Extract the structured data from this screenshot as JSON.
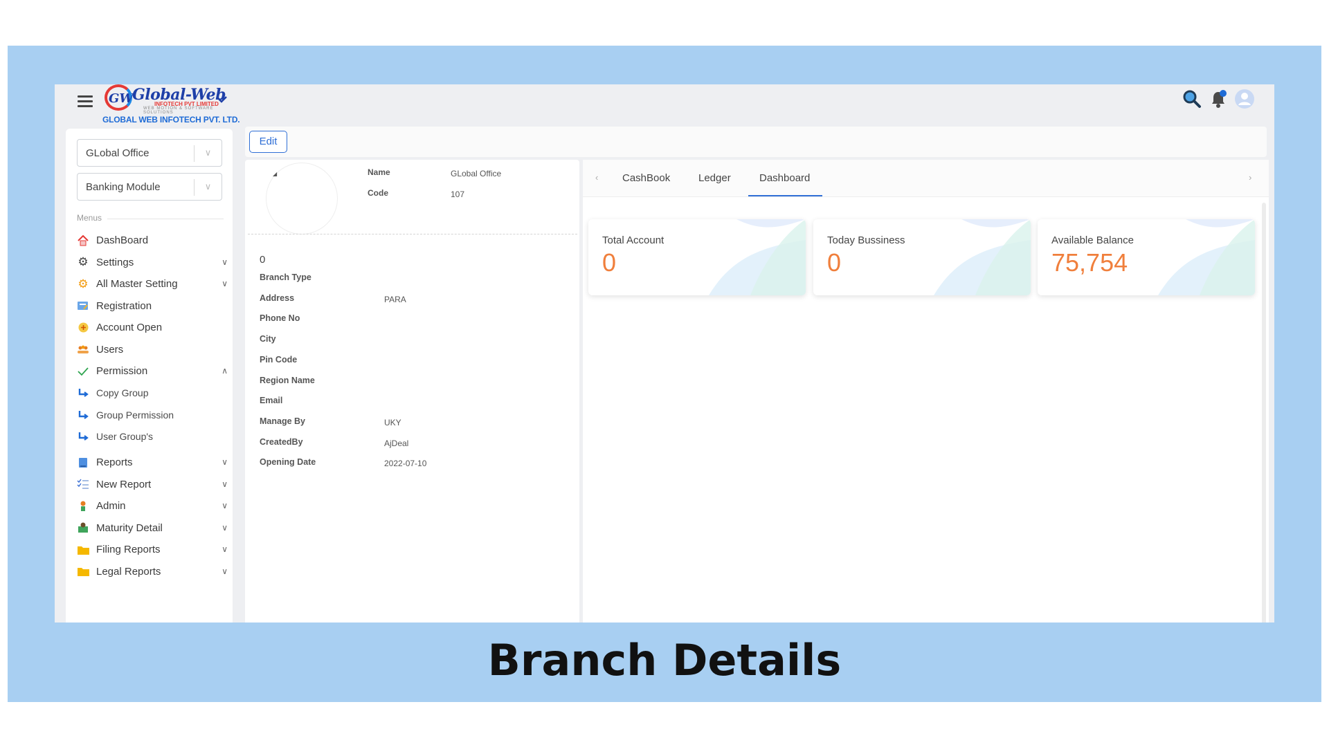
{
  "header": {
    "logo_text": "Global-Web",
    "logo_sub": "INFOTECH PVT LIMITED",
    "logo_tagline": "WEB MOTION & SOFTWARE SOLUTIONS",
    "company_name": "GLOBAL WEB INFOTECH PVT. LTD."
  },
  "sidebar": {
    "branch_select": "GLobal Office",
    "module_select": "Banking Module",
    "menus_label": "Menus",
    "items": [
      {
        "label": "DashBoard",
        "icon": "home-icon"
      },
      {
        "label": "Settings",
        "icon": "gear-icon"
      },
      {
        "label": "All Master Setting",
        "icon": "cog-orange-icon"
      },
      {
        "label": "Registration",
        "icon": "registration-icon"
      },
      {
        "label": "Account Open",
        "icon": "plus-circle-icon"
      },
      {
        "label": "Users",
        "icon": "users-icon"
      },
      {
        "label": "Permission",
        "icon": "check-icon"
      },
      {
        "label": "Copy Group",
        "icon": "sub-arrow-icon"
      },
      {
        "label": "Group Permission",
        "icon": "sub-arrow-icon"
      },
      {
        "label": "User Group's",
        "icon": "sub-arrow-icon"
      },
      {
        "label": "Reports",
        "icon": "report-icon"
      },
      {
        "label": "New Report",
        "icon": "checklist-icon"
      },
      {
        "label": "Admin",
        "icon": "admin-icon"
      },
      {
        "label": "Maturity Detail",
        "icon": "money-icon"
      },
      {
        "label": "Filing Reports",
        "icon": "folder-icon"
      },
      {
        "label": "Legal Reports",
        "icon": "folder-icon"
      }
    ]
  },
  "toolbar": {
    "edit_label": "Edit"
  },
  "branch": {
    "name_label": "Name",
    "name_value": "GLobal Office",
    "code_label": "Code",
    "code_value": "107",
    "zero": "0",
    "fields": [
      {
        "label": "Branch Type",
        "value": ""
      },
      {
        "label": "Address",
        "value": "PARA"
      },
      {
        "label": "Phone No",
        "value": ""
      },
      {
        "label": "City",
        "value": ""
      },
      {
        "label": "Pin Code",
        "value": ""
      },
      {
        "label": "Region Name",
        "value": ""
      },
      {
        "label": "Email",
        "value": ""
      },
      {
        "label": "Manage By",
        "value": "UKY"
      },
      {
        "label": "CreatedBy",
        "value": "AjDeal"
      },
      {
        "label": "Opening Date",
        "value": "2022-07-10"
      }
    ]
  },
  "tabs": [
    "CashBook",
    "Ledger",
    "Dashboard"
  ],
  "cards": [
    {
      "title": "Total Account",
      "value": "0"
    },
    {
      "title": "Today Bussiness",
      "value": "0"
    },
    {
      "title": "Available Balance",
      "value": "75,754"
    }
  ],
  "caption": "Branch Details",
  "colors": {
    "accent": "#2f6fd6",
    "number": "#f07f3c",
    "frame": "#a8cff2"
  }
}
